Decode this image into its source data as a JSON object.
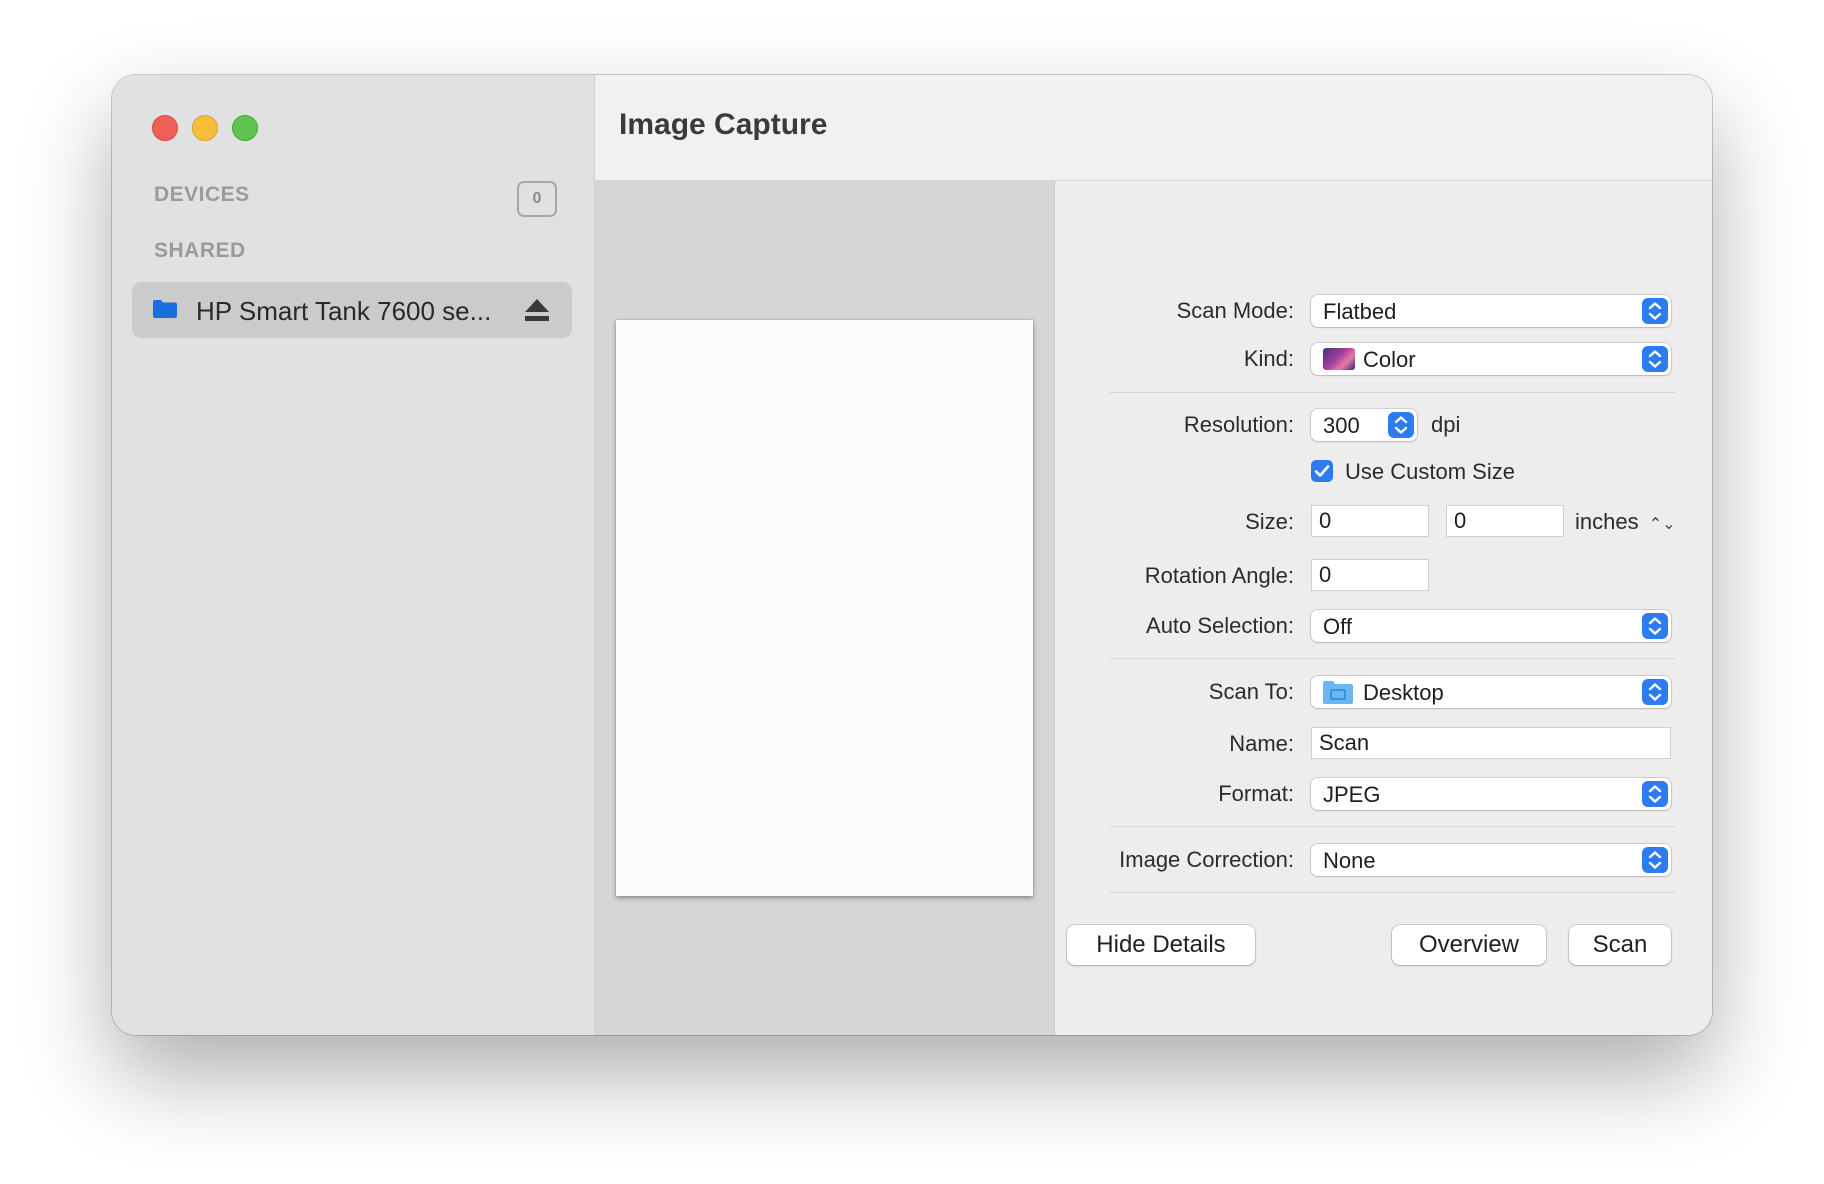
{
  "window": {
    "title": "Image Capture"
  },
  "sidebar": {
    "devices_header": "DEVICES",
    "devices_count": "0",
    "shared_header": "SHARED",
    "shared_items": [
      {
        "label": "HP Smart Tank 7600 se...",
        "icon": "folder-icon",
        "action_icon": "eject-icon"
      }
    ]
  },
  "details": {
    "scan_mode": {
      "label": "Scan Mode:",
      "value": "Flatbed"
    },
    "kind": {
      "label": "Kind:",
      "value": "Color",
      "icon": "color-image-icon"
    },
    "resolution": {
      "label": "Resolution:",
      "value": "300",
      "unit": "dpi"
    },
    "custom_size": {
      "label": "Use Custom Size",
      "checked": true
    },
    "size": {
      "label": "Size:",
      "width": "0",
      "height": "0",
      "unit": "inches"
    },
    "rotation": {
      "label": "Rotation Angle:",
      "value": "0"
    },
    "auto_selection": {
      "label": "Auto Selection:",
      "value": "Off"
    },
    "scan_to": {
      "label": "Scan To:",
      "value": "Desktop",
      "icon": "desktop-folder-icon"
    },
    "name": {
      "label": "Name:",
      "value": "Scan"
    },
    "format": {
      "label": "Format:",
      "value": "JPEG"
    },
    "image_correction": {
      "label": "Image Correction:",
      "value": "None"
    }
  },
  "buttons": {
    "hide_details": "Hide Details",
    "overview": "Overview",
    "scan": "Scan"
  },
  "colors": {
    "accent": "#2d7bf0",
    "close": "#ee5f57",
    "minimize": "#f6bc3a",
    "zoom": "#5fc44d",
    "folder_blue": "#1a6fe0"
  }
}
